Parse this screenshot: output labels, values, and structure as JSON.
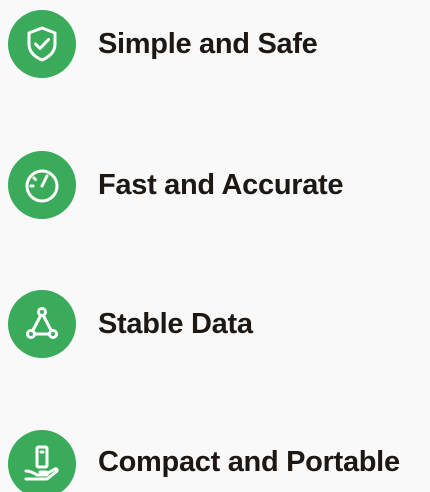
{
  "features": [
    {
      "label": "Simple and Safe",
      "icon": "shield-check-icon"
    },
    {
      "label": "Fast and Accurate",
      "icon": "gauge-icon"
    },
    {
      "label": "Stable Data",
      "icon": "triangle-nodes-icon"
    },
    {
      "label": "Compact and Portable",
      "icon": "hand-device-icon"
    }
  ],
  "colors": {
    "accent": "#3aaa5b",
    "text": "#1e1815",
    "background": "#f9f9f9"
  }
}
